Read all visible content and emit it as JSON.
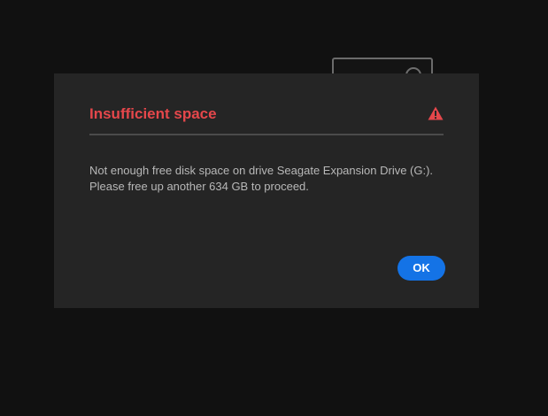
{
  "dialog": {
    "title": "Insufficient space",
    "icon": "warning-triangle-icon",
    "message_lines": [
      "Not enough free disk space on drive Seagate Expansion Drive (G:).",
      "Please free up another 634 GB to proceed."
    ],
    "ok_label": "OK"
  },
  "colors": {
    "page_background": "#111111",
    "dialog_background": "#252525",
    "title": "#e5474b",
    "warning_icon": "#e5474b",
    "message_text": "#b8b8b8",
    "divider": "#4b4b4b",
    "ok_button": "#1473e6"
  }
}
